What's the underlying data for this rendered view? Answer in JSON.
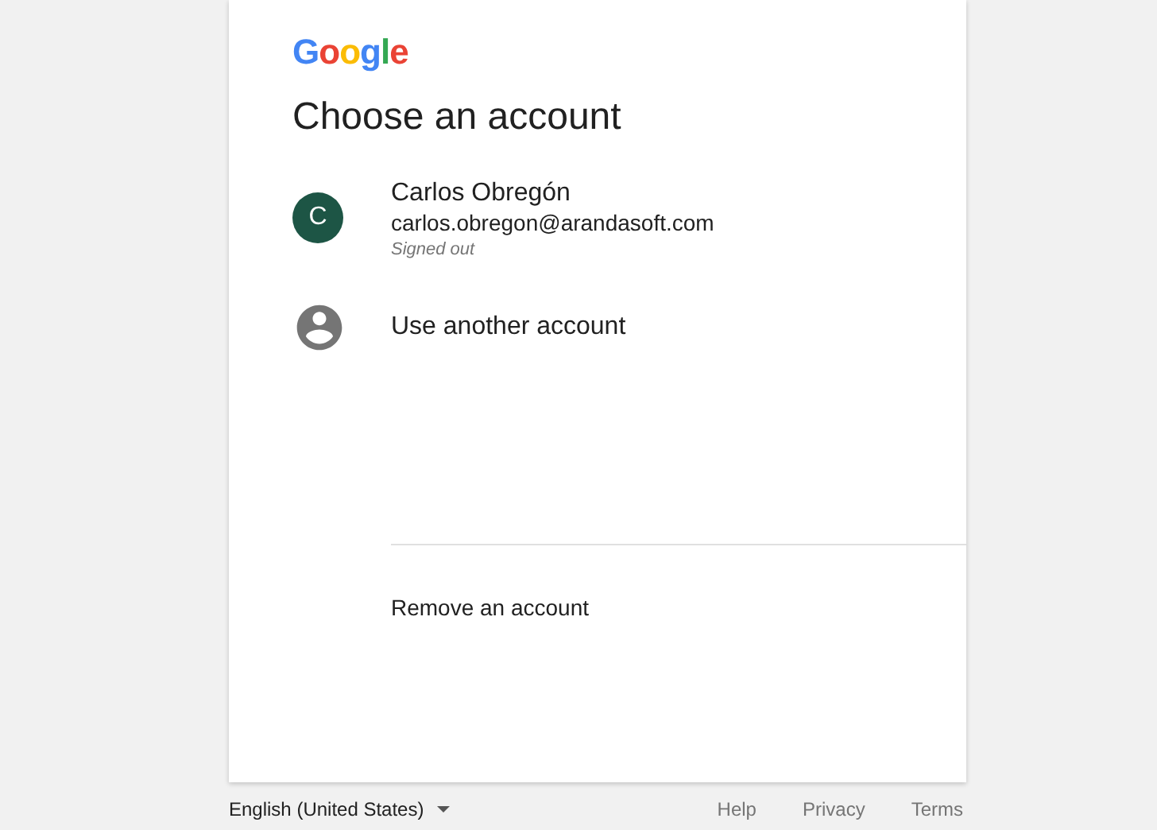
{
  "logo": "Google",
  "title": "Choose an account",
  "accounts": [
    {
      "kind": "account",
      "initial": "C",
      "color": "#1d5545",
      "name": "Carlos Obregón",
      "email": "carlos.obregon@arandasoft.com",
      "status": "Signed out"
    },
    {
      "kind": "other",
      "name": "Use another account"
    }
  ],
  "remove": "Remove an account",
  "footer": {
    "language": "English (United States)",
    "links": [
      "Help",
      "Privacy",
      "Terms"
    ]
  }
}
